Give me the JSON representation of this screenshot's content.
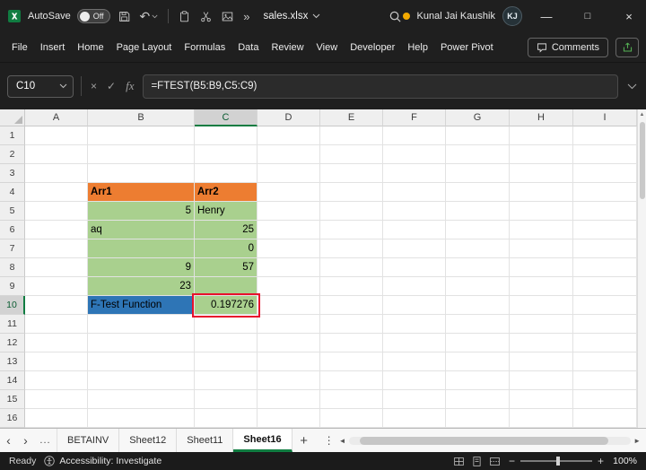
{
  "titlebar": {
    "autosave_label": "AutoSave",
    "autosave_state": "Off",
    "document_name": "sales.xlsx",
    "user_name": "Kunal Jai Kaushik",
    "user_initials": "KJ"
  },
  "icons": {
    "undo": "↶",
    "overflow": "»",
    "cancel": "×",
    "enter": "✓",
    "fx": "fx",
    "ellipsis": "...",
    "add": "+",
    "kebab": "⋮",
    "nav_left": "‹",
    "nav_right": "›",
    "minimize": "—",
    "maximize": "□",
    "close": "×",
    "scroll_up": "▲",
    "scroll_left": "◄",
    "scroll_right": "►",
    "zoom_out": "−",
    "zoom_in": "+"
  },
  "menubar": {
    "tabs": [
      "File",
      "Insert",
      "Home",
      "Page Layout",
      "Formulas",
      "Data",
      "Review",
      "View",
      "Developer",
      "Help",
      "Power Pivot"
    ],
    "comments_label": "Comments"
  },
  "formula_bar": {
    "name_box": "C10",
    "formula": "=FTEST(B5:B9,C5:C9)"
  },
  "grid": {
    "columns": [
      "A",
      "B",
      "C",
      "D",
      "E",
      "F",
      "G",
      "H",
      "I"
    ],
    "rows": 16,
    "selected_cell": "C10",
    "selected_column": "C",
    "selected_row": 10,
    "cells": [
      {
        "ref": "B4",
        "text": "Arr1",
        "bg": "#ED7D31",
        "bold": true,
        "align": "left"
      },
      {
        "ref": "C4",
        "text": "Arr2",
        "bg": "#ED7D31",
        "bold": true,
        "align": "left"
      },
      {
        "ref": "B5",
        "text": "5",
        "bg": "#A9D08E",
        "align": "right"
      },
      {
        "ref": "C5",
        "text": "Henry",
        "bg": "#A9D08E",
        "align": "left"
      },
      {
        "ref": "B6",
        "text": "aq",
        "bg": "#A9D08E",
        "align": "left"
      },
      {
        "ref": "C6",
        "text": "25",
        "bg": "#A9D08E",
        "align": "right"
      },
      {
        "ref": "B7",
        "text": "",
        "bg": "#A9D08E",
        "align": "left"
      },
      {
        "ref": "C7",
        "text": "0",
        "bg": "#A9D08E",
        "align": "right"
      },
      {
        "ref": "B8",
        "text": "9",
        "bg": "#A9D08E",
        "align": "right"
      },
      {
        "ref": "C8",
        "text": "57",
        "bg": "#A9D08E",
        "align": "right"
      },
      {
        "ref": "B9",
        "text": "23",
        "bg": "#A9D08E",
        "align": "right"
      },
      {
        "ref": "C9",
        "text": "",
        "bg": "#A9D08E",
        "align": "left"
      },
      {
        "ref": "B10",
        "text": "F-Test Function",
        "bg": "#2E75B6",
        "align": "left"
      },
      {
        "ref": "C10",
        "text": "0.197276",
        "bg": "#A9D08E",
        "align": "right",
        "selected": true,
        "annotated": true
      }
    ]
  },
  "sheet_tabs": {
    "tabs": [
      "BETAINV",
      "Sheet12",
      "Sheet11",
      "Sheet16"
    ],
    "active": "Sheet16"
  },
  "status_bar": {
    "mode": "Ready",
    "accessibility": "Accessibility: Investigate",
    "zoom": "100%"
  },
  "colors": {
    "accent_green": "#107C41",
    "header_orange": "#ED7D31",
    "cell_green": "#A9D08E",
    "label_blue": "#2E75B6",
    "annotation_red": "#E8112D",
    "titlebar_bg": "#1F1F1F"
  }
}
